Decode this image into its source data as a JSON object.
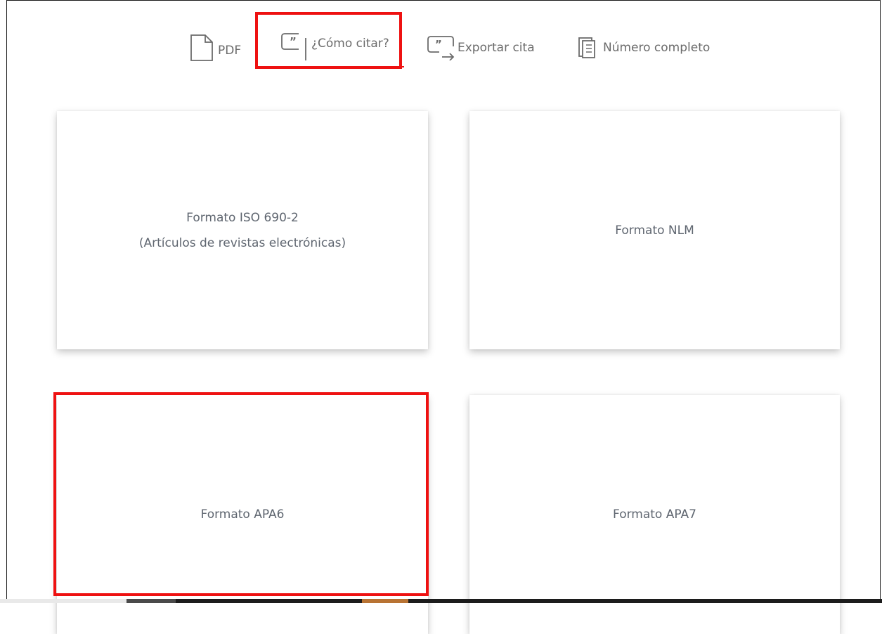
{
  "toolbar": {
    "pdf": {
      "label": "PDF",
      "icon": "document-icon"
    },
    "cite": {
      "label": "¿Cómo citar?",
      "icon": "quote-icon"
    },
    "export": {
      "label": "Exportar cita",
      "icon": "export-quote-icon"
    },
    "issue": {
      "label": "Número completo",
      "icon": "book-icon"
    }
  },
  "cards": {
    "iso": {
      "line1": "Formato ISO 690-2",
      "line2": "(Artículos de revistas electrónicas)"
    },
    "nlm": {
      "label": "Formato NLM"
    },
    "apa6": {
      "label": "Formato APA6"
    },
    "apa7": {
      "label": "Formato APA7"
    }
  },
  "colors": {
    "highlight": "#ee1111",
    "text": "#5f6670",
    "icon": "#6b6b6b"
  }
}
